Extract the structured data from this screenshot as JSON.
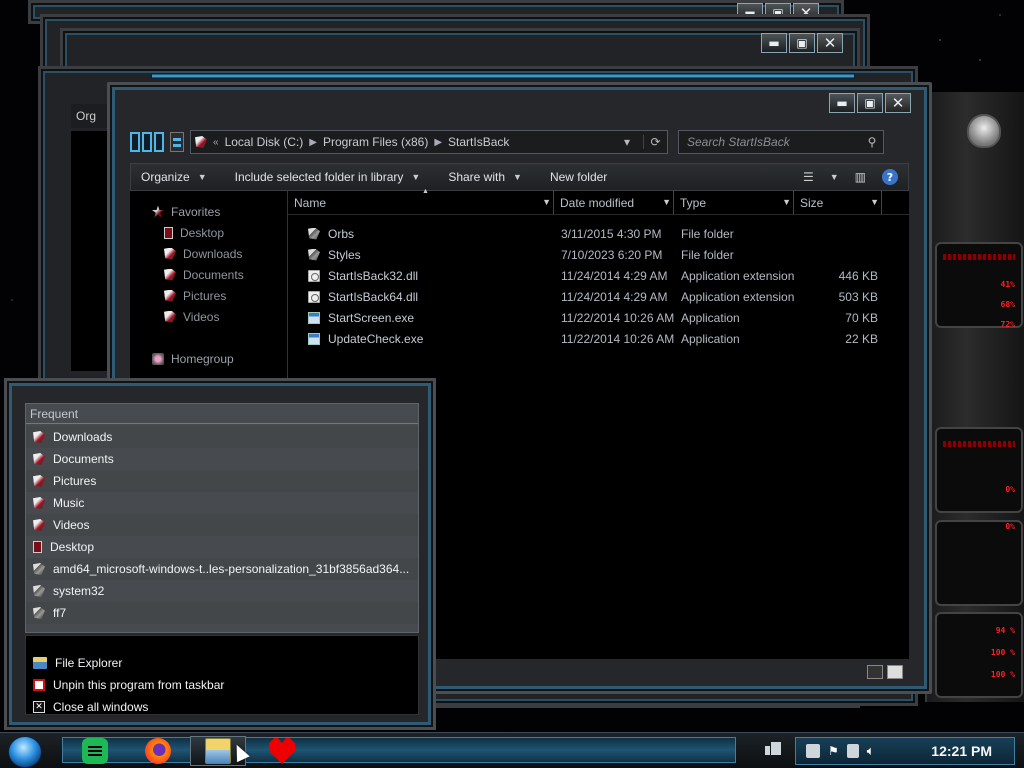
{
  "explorer": {
    "address": [
      "Local Disk (C:)",
      "Program Files (x86)",
      "StartIsBack"
    ],
    "search_placeholder": "Search StartIsBack",
    "commands": [
      "Organize",
      "Include selected folder in library",
      "Share with",
      "New folder"
    ],
    "nav": {
      "favorites": "Favorites",
      "favorites_items": [
        "Desktop",
        "Downloads",
        "Documents",
        "Pictures",
        "Videos"
      ],
      "homegroup": "Homegroup"
    },
    "columns": [
      "Name",
      "Date modified",
      "Type",
      "Size"
    ],
    "files": [
      {
        "name": "Orbs",
        "date": "3/11/2015 4:30 PM",
        "type": "File folder",
        "size": "",
        "icon": "folder-icon"
      },
      {
        "name": "Styles",
        "date": "7/10/2023 6:20 PM",
        "type": "File folder",
        "size": "",
        "icon": "folder-icon"
      },
      {
        "name": "StartIsBack32.dll",
        "date": "11/24/2014 4:29 AM",
        "type": "Application extension",
        "size": "446 KB",
        "icon": "dll-icon"
      },
      {
        "name": "StartIsBack64.dll",
        "date": "11/24/2014 4:29 AM",
        "type": "Application extension",
        "size": "503 KB",
        "icon": "dll-icon"
      },
      {
        "name": "StartScreen.exe",
        "date": "11/22/2014 10:26 AM",
        "type": "Application",
        "size": "70 KB",
        "icon": "app-icon"
      },
      {
        "name": "UpdateCheck.exe",
        "date": "11/22/2014 10:26 AM",
        "type": "Application",
        "size": "22 KB",
        "icon": "app-icon"
      }
    ]
  },
  "background_windows": {
    "partial_label": "Org"
  },
  "jumplist": {
    "header": "Frequent",
    "items": [
      "Downloads",
      "Documents",
      "Pictures",
      "Music",
      "Videos",
      "Desktop",
      "amd64_microsoft-windows-t..les-personalization_31bf3856ad364...",
      "system32",
      "ff7"
    ],
    "tasks": [
      "File Explorer",
      "Unpin this program from taskbar",
      "Close all windows"
    ]
  },
  "taskbar": {
    "clock": "12:21 PM",
    "pinned": [
      "spotify-icon",
      "firefox-icon",
      "file-explorer-icon",
      "heart-icon"
    ]
  },
  "gadget": {
    "readouts": [
      "41%",
      "68%",
      "72%",
      "0%",
      "0%",
      "94 %",
      "100 %",
      "100 %"
    ]
  },
  "colors": {
    "accent": "#4fb6e6",
    "frame": "#4a4d52",
    "clock_text": "#f4f7f9",
    "gadget_red": "#ff2020"
  }
}
